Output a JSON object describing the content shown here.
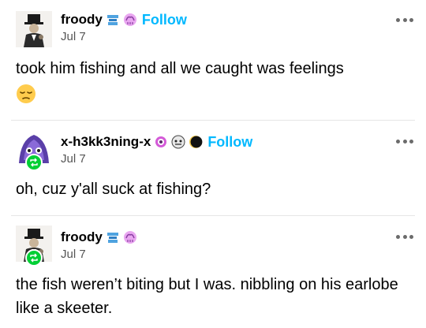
{
  "posts": [
    {
      "username": "froody",
      "date": "Jul 7",
      "follow_label": "Follow",
      "text": "took him fishing and all we caught was feelings",
      "emoji": "pensive-face"
    },
    {
      "username": "x-h3kk3ning-x",
      "date": "Jul 7",
      "follow_label": "Follow",
      "text": "oh, cuz y'all suck at fishing?"
    },
    {
      "username": "froody",
      "date": "Jul 7",
      "text": "the fish weren’t biting but I was. nibbling on his earlobe like a skeeter."
    }
  ],
  "colors": {
    "follow": "#00b8ff",
    "reblog_badge": "#00cf35",
    "meta_text": "#555555",
    "divider": "#e6e6e6"
  }
}
